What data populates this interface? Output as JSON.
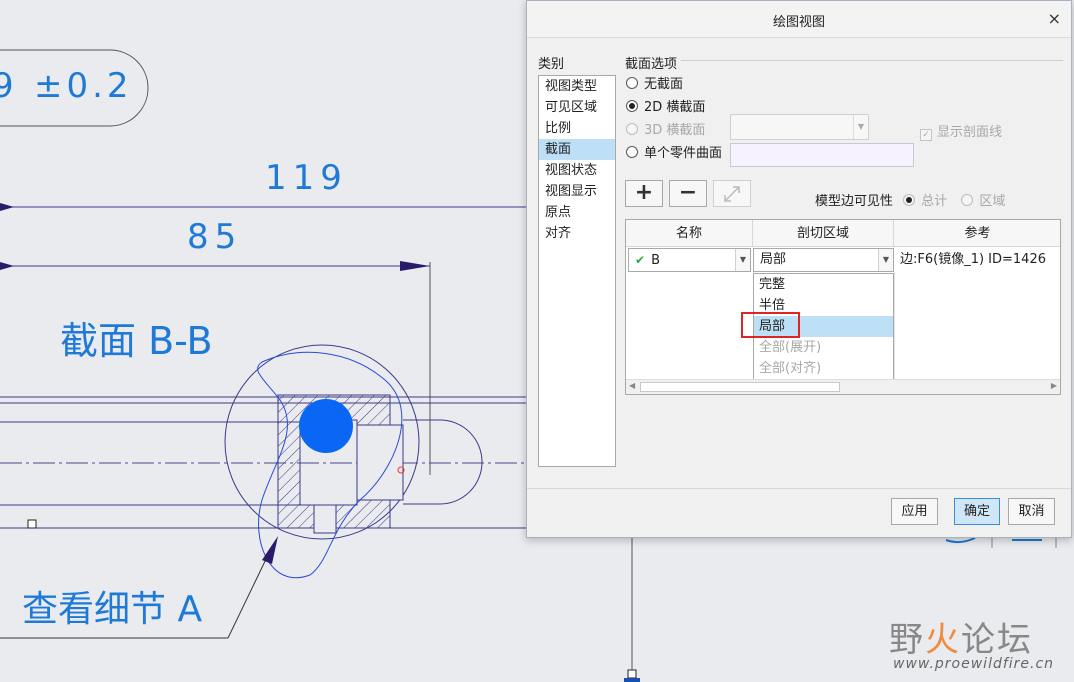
{
  "drawing": {
    "tolerance": "±0.2",
    "tolerance_partial": "9",
    "dim_119": "119",
    "dim_85": "85",
    "section_label": "截面 B-B",
    "detail_label": "查看细节 A"
  },
  "dialog": {
    "title": "绘图视图",
    "close_glyph": "×",
    "categories_label": "类别",
    "categories": [
      "视图类型",
      "可见区域",
      "比例",
      "截面",
      "视图状态",
      "视图显示",
      "原点",
      "对齐"
    ],
    "selected_category": "截面",
    "section_options_label": "截面选项",
    "options": {
      "none": "无截面",
      "2d": "2D 横截面",
      "3d": "3D 横截面",
      "single": "单个零件曲面"
    },
    "show_hatch_label": "显示剖面线",
    "add_glyph": "+",
    "remove_glyph": "−",
    "model_edge_visibility_label": "模型边可见性",
    "vis_total": "总计",
    "vis_region": "区域",
    "table": {
      "headers": [
        "名称",
        "剖切区域",
        "参考"
      ],
      "row": {
        "name": "B",
        "region": "局部",
        "reference": "边:F6(镜像_1) ID=1426"
      }
    },
    "dropdown_options": [
      {
        "label": "完整",
        "disabled": false
      },
      {
        "label": "半倍",
        "disabled": false
      },
      {
        "label": "局部",
        "disabled": false,
        "selected": true
      },
      {
        "label": "全部(展开)",
        "disabled": true
      },
      {
        "label": "全部(对齐)",
        "disabled": true
      }
    ],
    "buttons": {
      "apply": "应用",
      "ok": "确定",
      "cancel": "取消"
    }
  },
  "watermark": {
    "brand_a": "野",
    "brand_b": "火",
    "brand_c": "论坛",
    "url": "www.proewildfire.cn"
  },
  "colors": {
    "cad_blue": "#1e7ad6",
    "accent": "#3d8ed8",
    "highlight": "#e02424",
    "selection": "#bde0f7"
  }
}
